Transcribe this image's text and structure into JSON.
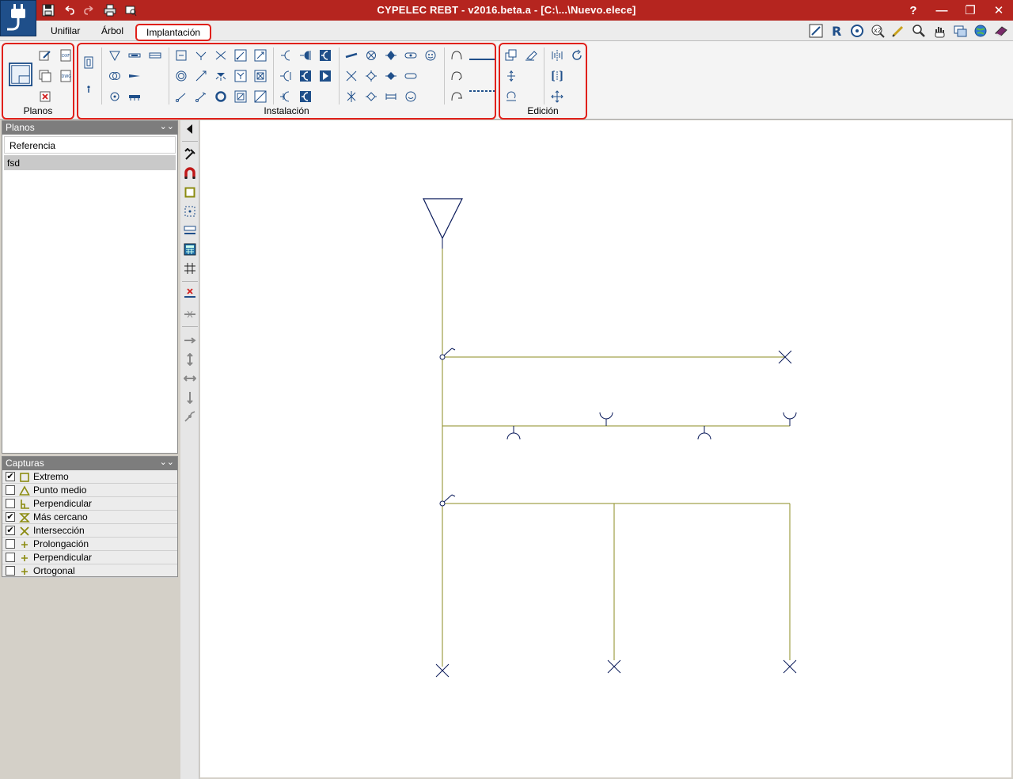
{
  "window": {
    "title": "CYPELEC REBT - v2016.beta.a - [C:\\...\\Nuevo.elece]",
    "help": "?",
    "minimize": "—",
    "maximize": "❐",
    "close": "✕"
  },
  "tabs": [
    "Unifilar",
    "Árbol",
    "Implantación"
  ],
  "ribbon": {
    "groups": [
      "Planos",
      "Instalación",
      "Edición"
    ]
  },
  "planos_panel": {
    "title": "Planos",
    "column_header": "Referencia",
    "rows": [
      "fsd"
    ]
  },
  "capturas_panel": {
    "title": "Capturas",
    "items": [
      {
        "label": "Extremo",
        "checked": true,
        "icon": "square-snap-icon"
      },
      {
        "label": "Punto medio",
        "checked": false,
        "icon": "triangle-snap-icon"
      },
      {
        "label": "Perpendicular",
        "checked": false,
        "icon": "perpendicular-snap-icon"
      },
      {
        "label": "Más cercano",
        "checked": true,
        "icon": "hourglass-snap-icon"
      },
      {
        "label": "Intersección",
        "checked": true,
        "icon": "x-snap-icon"
      },
      {
        "label": "Prolongación",
        "checked": false,
        "icon": "plus-snap-icon"
      },
      {
        "label": "Perpendicular",
        "checked": false,
        "icon": "plus-snap-icon"
      },
      {
        "label": "Ortogonal",
        "checked": false,
        "icon": "plus-snap-icon"
      }
    ]
  },
  "colors": {
    "title_bar": "#b5251f",
    "highlight": "#e0201a",
    "wire": "#8b8b22",
    "symbol": "#0a1a5a",
    "icon_blue": "#1f4f8a"
  }
}
